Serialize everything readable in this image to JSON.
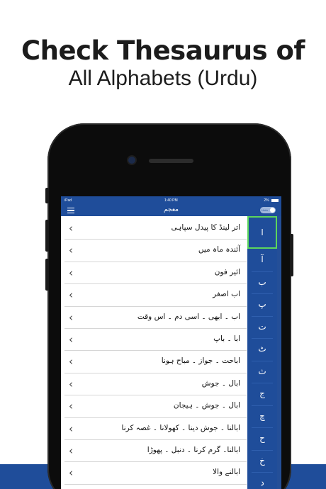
{
  "promo": {
    "headline_line1": "Check Thesaurus of",
    "headline_line2": "All Alphabets (Urdu)"
  },
  "statusbar": {
    "carrier": "iPad",
    "time": "1:40 PM",
    "battery": "2%"
  },
  "navbar": {
    "title": "معجم",
    "toggle_label": "Urdu"
  },
  "list": {
    "items": [
      "اتر لینڈ کا پیدل سپاہی",
      "آئندہ ماہ میں",
      "ائیر فون",
      "اب اصغر",
      "اب ۔ ابھی ۔ اسی دم ۔ اس وقت",
      "ابا ۔ باپ",
      "اباحت ۔ جواز ۔ مباح ہونا",
      "ابال ۔ جوش",
      "ابال ۔ جوش ۔ ہیجان",
      "ابالنا ۔ جوش دینا ۔ کھولانا ۔ غصہ کرنا",
      "ابالنا۔ گرم کرنا ۔ دنبل ۔ پھوڑا",
      "ابالنے والا"
    ]
  },
  "alphabet": {
    "selected": "ا",
    "letters": [
      "ا",
      "آ",
      "ب",
      "پ",
      "ت",
      "ٹ",
      "ث",
      "ج",
      "چ",
      "ح",
      "خ",
      "د"
    ]
  },
  "colors": {
    "brand_blue": "#1f4d9a",
    "selected_outline": "#5cd65c"
  },
  "icons": [
    "menu-icon",
    "chevron-left-icon"
  ]
}
